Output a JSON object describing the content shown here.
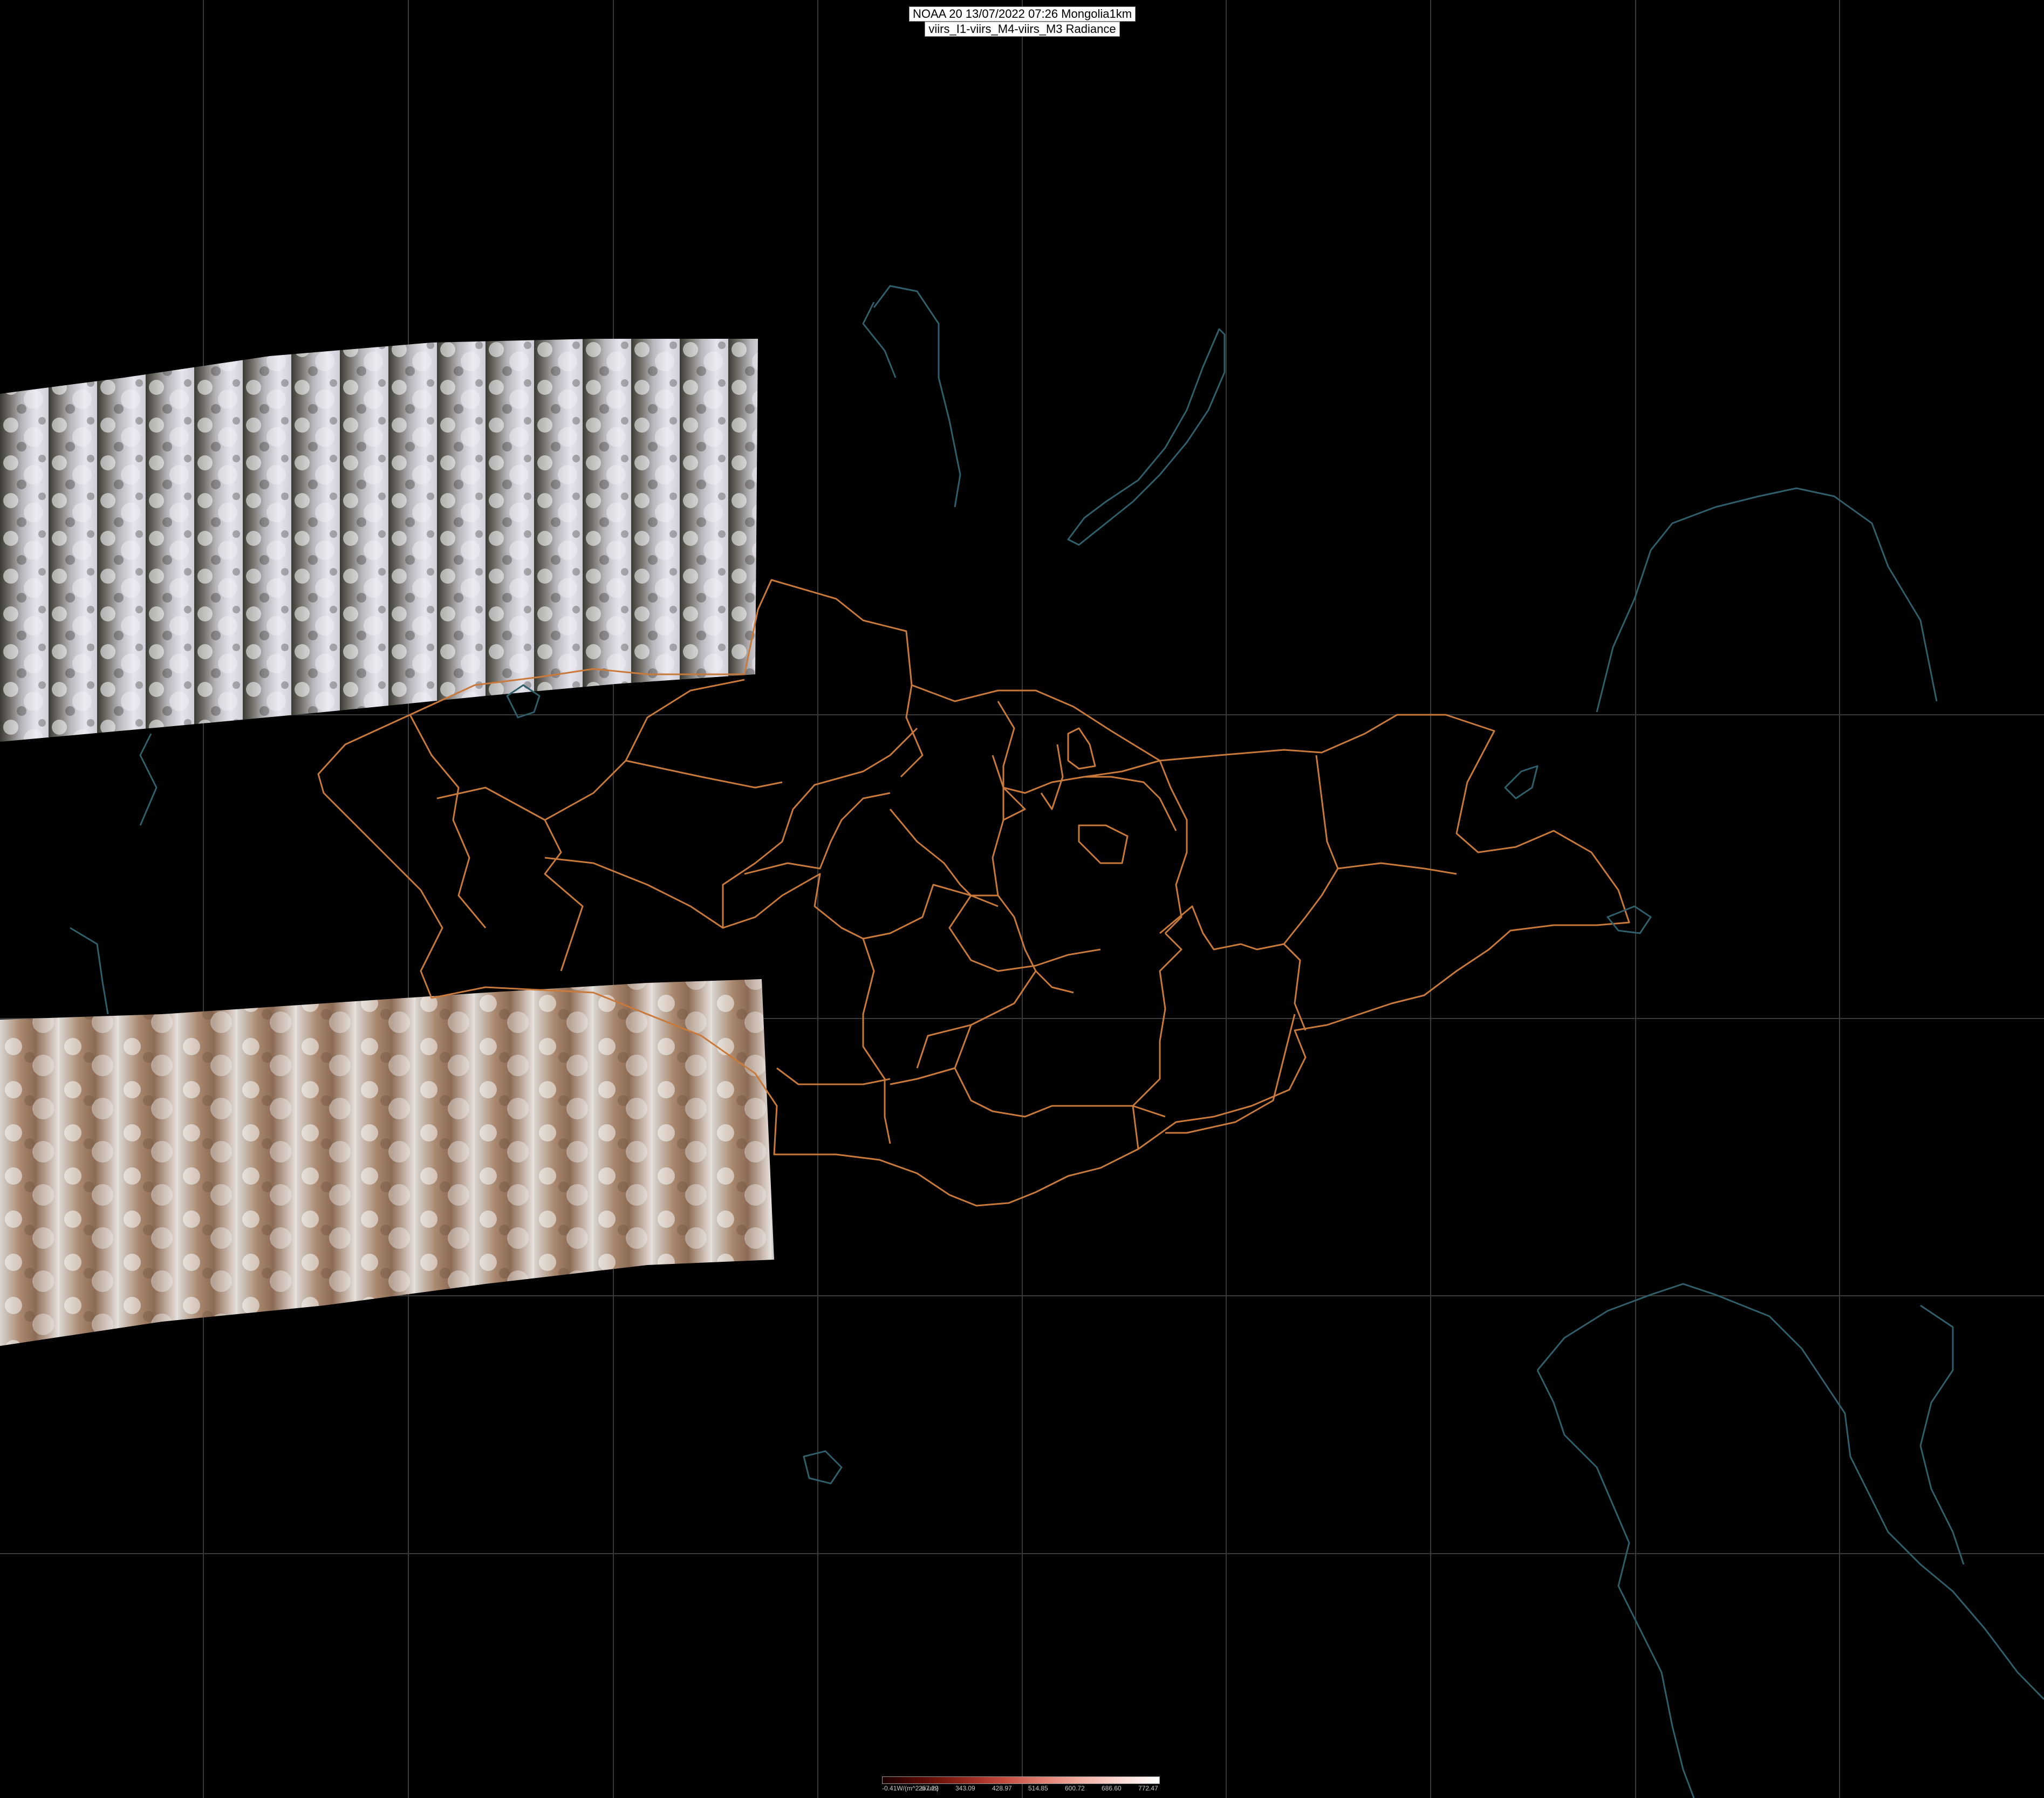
{
  "header": {
    "line1": "NOAA 20 13/07/2022 07:26 Mongolia1km",
    "line2": "viirs_I1-viirs_M4-viirs_M3 Radiance"
  },
  "colors": {
    "background": "#000000",
    "graticule": "#3a3a3a",
    "admin_borders": "#c97a3a",
    "coastline": "#2f5f6a"
  },
  "colorbar": {
    "ticks": [
      "-0.41W/(m^2.sr.um)",
      "257.22",
      "343.09",
      "428.97",
      "514.85",
      "600.72",
      "686.60",
      "772.47"
    ],
    "colors": [
      "#1a0000",
      "#5a0a05",
      "#8f2418",
      "#c0483a",
      "#e07d6e",
      "#f2aea3",
      "#fbd9d3",
      "#ffffff"
    ]
  },
  "layers": {
    "swath_1": "satellite-swath-north",
    "swath_2": "satellite-swath-south"
  }
}
